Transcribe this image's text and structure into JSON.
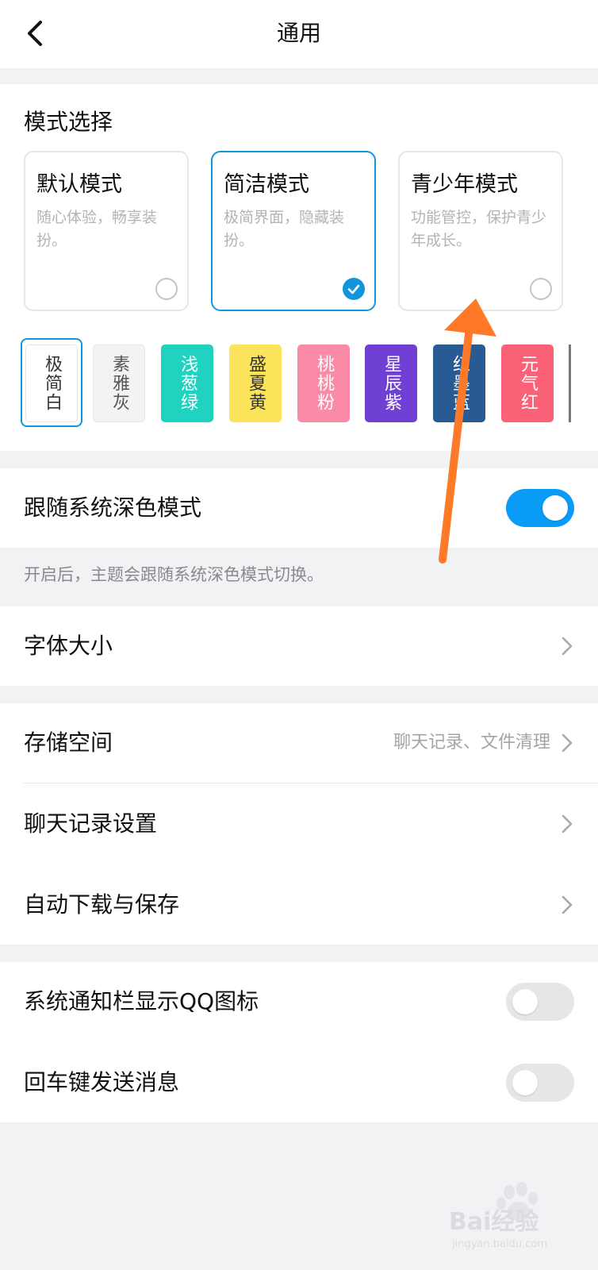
{
  "header": {
    "title": "通用",
    "back_icon": "chevron-left-icon"
  },
  "theme_mode": {
    "section_title": "模式选择",
    "modes": [
      {
        "name": "默认模式",
        "desc": "随心体验，畅享装扮。",
        "selected": false
      },
      {
        "name": "简洁模式",
        "desc": "极简界面，隐藏装扮。",
        "selected": true
      },
      {
        "name": "青少年模式",
        "desc": "功能管控，保护青少年成长。",
        "selected": false
      }
    ],
    "accent_color": "#1296db"
  },
  "color_swatches": [
    {
      "label": "极简白",
      "color": "#ffffff",
      "text_color": "#333333",
      "selected": true
    },
    {
      "label": "素雅灰",
      "color": "#f2f3f5",
      "text_color": "#555555",
      "selected": false
    },
    {
      "label": "浅葱绿",
      "color": "#1fd3c0",
      "text_color": "#ffffff",
      "selected": false
    },
    {
      "label": "盛夏黄",
      "color": "#fce45a",
      "text_color": "#333333",
      "selected": false
    },
    {
      "label": "桃桃粉",
      "color": "#fb8aa7",
      "text_color": "#ffffff",
      "selected": false
    },
    {
      "label": "星辰紫",
      "color": "#7040d4",
      "text_color": "#ffffff",
      "selected": false
    },
    {
      "label": "红墨蓝",
      "color": "#285a94",
      "text_color": "#ffffff",
      "selected": false
    },
    {
      "label": "元气红",
      "color": "#fb6277",
      "text_color": "#ffffff",
      "selected": false
    }
  ],
  "dark_mode": {
    "label": "跟随系统深色模式",
    "enabled": true,
    "hint": "开启后，主题会跟随系统深色模式切换。"
  },
  "font_size": {
    "label": "字体大小"
  },
  "storage": {
    "label": "存储空间",
    "trail": "聊天记录、文件清理"
  },
  "chat_history": {
    "label": "聊天记录设置"
  },
  "auto_download": {
    "label": "自动下载与保存"
  },
  "notif_icon": {
    "label": "系统通知栏显示QQ图标",
    "enabled": false
  },
  "enter_send": {
    "label": "回车键发送消息",
    "enabled": false
  },
  "watermark": {
    "text": "Bai经验",
    "sub": "jingyan.baidu.com"
  },
  "annotation_color": "#ff7a28"
}
